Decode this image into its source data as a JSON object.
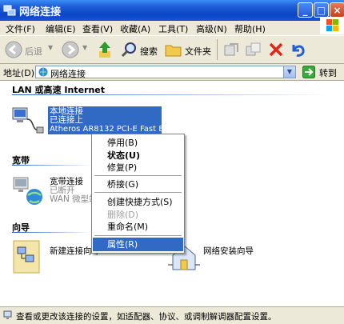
{
  "window": {
    "title": "网络连接"
  },
  "menu": [
    "文件(F)",
    "编辑(E)",
    "查看(V)",
    "收藏(A)",
    "工具(T)",
    "高级(N)",
    "帮助(H)"
  ],
  "toolbar": {
    "back_label": "后退",
    "search_label": "搜索",
    "folders_label": "文件夹"
  },
  "address": {
    "label": "地址(D)",
    "value": "网络连接",
    "go_label": "转到"
  },
  "groups": {
    "lan": {
      "title": "LAN 或高速 Internet",
      "item": {
        "name": "本地连接",
        "status": "已连接上",
        "device": "Atheros AR8132 PCI-E Fast Et..."
      }
    },
    "broadband": {
      "title": "宽带",
      "item": {
        "name": "宽带连接",
        "status": "已断开",
        "device": "WAN 微型端"
      }
    },
    "wizard": {
      "title": "向导",
      "new_conn": "新建连接向导",
      "home_net": "网络安装向导"
    }
  },
  "context_menu": {
    "items": [
      {
        "label": "停用(B)"
      },
      {
        "label": "状态(U)"
      },
      {
        "label": "修复(P)"
      },
      {
        "label": "桥接(G)"
      },
      {
        "label": "创建快捷方式(S)"
      },
      {
        "label": "删除(D)"
      },
      {
        "label": "重命名(M)"
      },
      {
        "label": "属性(R)"
      }
    ]
  },
  "status": {
    "text": "查看或更改该连接的设置，如适配器、协议、或调制解调器配置设置。"
  },
  "colors": {
    "selection": "#316ac5",
    "titlebar": "#0a46c4",
    "chrome": "#ece9d8"
  }
}
